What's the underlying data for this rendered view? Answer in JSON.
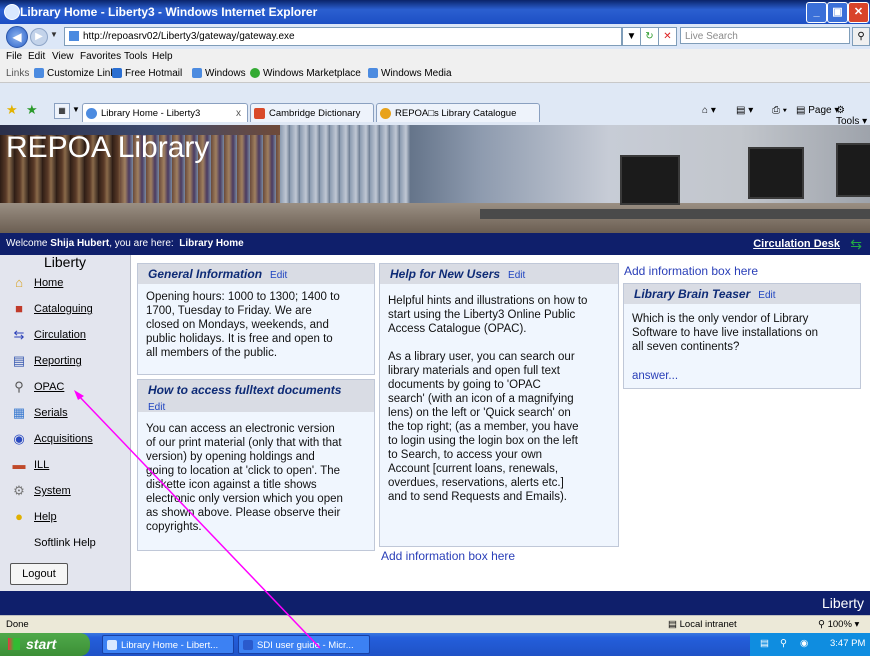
{
  "window": {
    "title": "Library Home - Liberty3 - Windows Internet Explorer"
  },
  "address_bar": {
    "url": "http://repoasrv02/Liberty3/gateway/gateway.exe",
    "search_placeholder": "Live Search"
  },
  "menu": [
    "File",
    "Edit",
    "View",
    "Favorites",
    "Tools",
    "Help"
  ],
  "links_bar": {
    "label": "Links",
    "items": [
      "Customize Links",
      "Free Hotmail",
      "Windows",
      "Windows Marketplace",
      "Windows Media"
    ]
  },
  "tabs": [
    {
      "label": "Library Home - Liberty3",
      "close": "x"
    },
    {
      "label": "Cambridge Dictionary Online:..."
    },
    {
      "label": "REPOA□s Library Catalogue"
    }
  ],
  "toolbar_right": {
    "page": "Page",
    "tools": "Tools"
  },
  "banner": {
    "title": "REPOA Library"
  },
  "welcome": {
    "prefix": "Welcome",
    "user": "Shija Hubert",
    "middle": ", you are here:",
    "location": "Library Home",
    "circulation_desk": "Circulation Desk"
  },
  "sidebar": {
    "title": "Liberty",
    "items": [
      {
        "label": "Home",
        "icon": "home-icon"
      },
      {
        "label": "Cataloguing",
        "icon": "cataloguing-icon"
      },
      {
        "label": "Circulation",
        "icon": "circulation-icon"
      },
      {
        "label": "Reporting",
        "icon": "reporting-icon"
      },
      {
        "label": "OPAC",
        "icon": "opac-search-icon"
      },
      {
        "label": "Serials",
        "icon": "serials-icon"
      },
      {
        "label": "Acquisitions",
        "icon": "acquisitions-icon"
      },
      {
        "label": "ILL",
        "icon": "ill-icon"
      },
      {
        "label": "System",
        "icon": "system-icon"
      },
      {
        "label": "Help",
        "icon": "help-bulb-icon"
      }
    ],
    "softlink_help": "Softlink Help",
    "logout": "Logout"
  },
  "boxes": {
    "general": {
      "title": "General Information",
      "edit": "Edit",
      "lines": [
        "Opening hours: 1000 to 1300; 1400 to",
        "1700, Tuesday to Friday. We are",
        "closed on Mondays, weekends, and",
        "public holidays. It is free and open to",
        "all members of the public."
      ]
    },
    "fulltext": {
      "title": "How to access fulltext documents",
      "edit": "Edit",
      "lines": [
        "You can access an electronic version",
        "of our print material (only that with that",
        "version) by opening holdings and",
        "going to location at 'click to open'. The",
        "diskette icon against a title shows",
        "electronic only version which you open",
        "as shown above. Please observe their",
        "copyrights."
      ]
    },
    "help_users": {
      "title": "Help for New Users",
      "edit": "Edit",
      "lines": [
        "Helpful hints and illustrations on how to",
        "start using the Liberty3 Online Public",
        "Access Catalogue (OPAC).",
        "",
        "As a library user, you can search our",
        "library materials and open full text",
        "documents by going to 'OPAC",
        "search' (with an icon of a magnifying",
        "lens) on the left or 'Quick search' on",
        "the top right; (as a member, you have",
        "to login using the login box on the left",
        "to Search, to access your own",
        "Account [current loans, renewals,",
        "overdues, reservations, alerts etc.]",
        "and to send Requests and Emails)."
      ]
    },
    "brain_teaser": {
      "title": "Library Brain Teaser",
      "edit": "Edit",
      "lines": [
        "Which is the only vendor of Library",
        "Software to have live installations on",
        "all seven continents?"
      ],
      "answer": "answer..."
    },
    "add_info_top": "Add information box here",
    "add_info_bottom": "Add information box here"
  },
  "footer": {
    "brand": "Liberty"
  },
  "status_bar": {
    "status": "Done",
    "zone": "Local intranet",
    "zoom": "100%"
  },
  "taskbar": {
    "start": "start",
    "buttons": [
      "Library Home - Libert...",
      "SDI user guide - Micr..."
    ],
    "clock": "3:47 PM"
  },
  "colors": {
    "header_navy": "#0f1f6b",
    "box_title": "#0e2b76",
    "pointer_magenta": "#ff00ff"
  }
}
